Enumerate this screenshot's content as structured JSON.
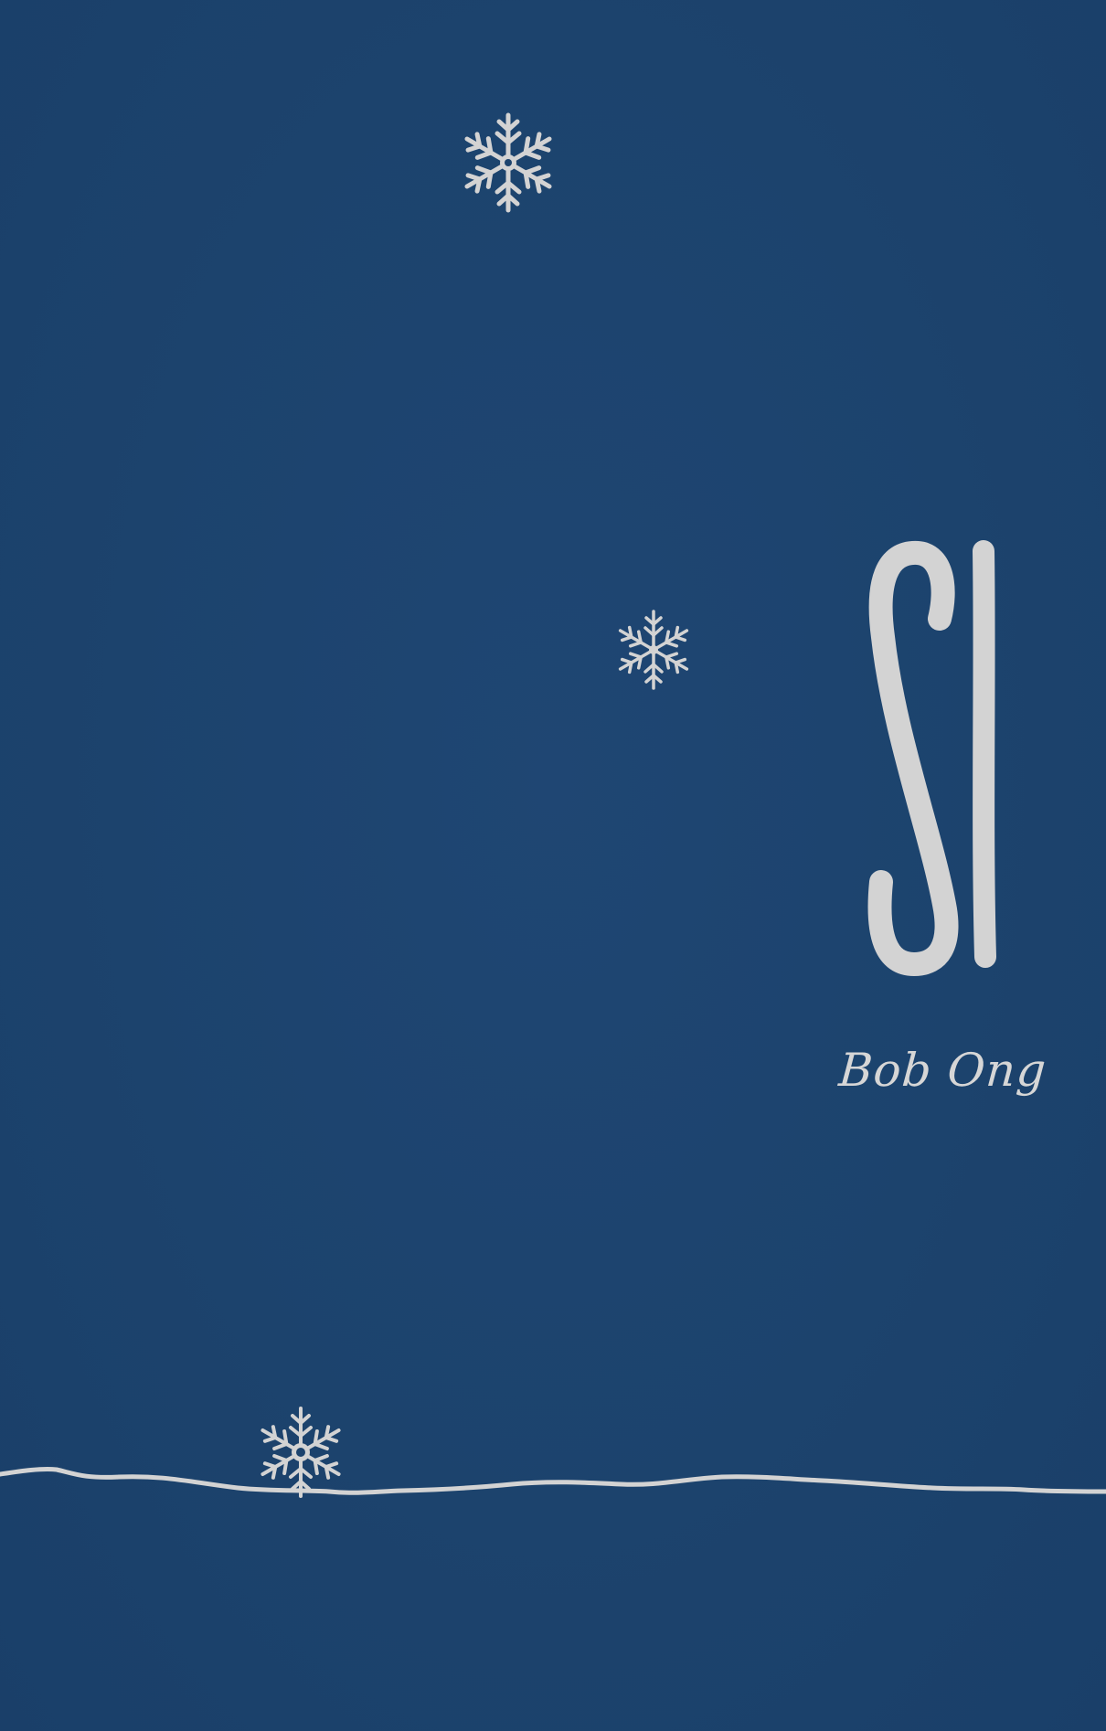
{
  "cover": {
    "title": "SI",
    "author": "Bob Ong",
    "background_color": "#1c436d",
    "ink_color": "#d3d3d3"
  },
  "decorations": {
    "snowflakes": [
      {
        "name": "snowflake-icon"
      },
      {
        "name": "snowflake-icon"
      },
      {
        "name": "snowflake-icon"
      }
    ],
    "ground_line": "hand-drawn-snow-line"
  }
}
